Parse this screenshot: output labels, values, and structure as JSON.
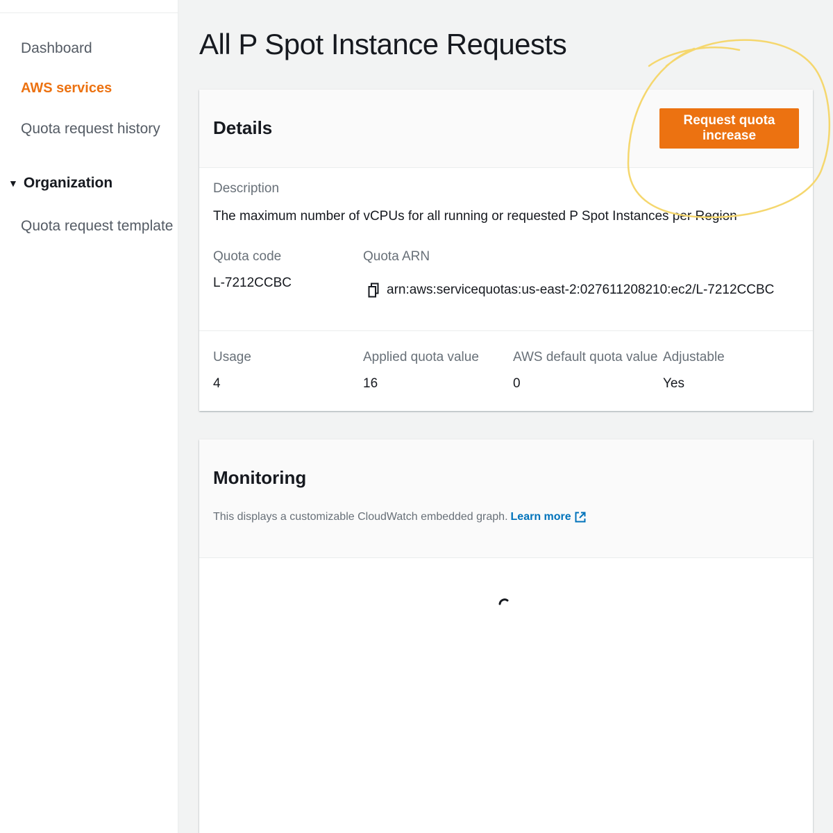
{
  "sidebar": {
    "items": [
      {
        "label": "Dashboard"
      },
      {
        "label": "AWS services",
        "active": true
      },
      {
        "label": "Quota request history"
      }
    ],
    "section": {
      "label": "Organization",
      "expanded": true
    },
    "section_items": [
      {
        "label": "Quota request template"
      }
    ]
  },
  "page": {
    "title": "All P Spot Instance Requests"
  },
  "details": {
    "title": "Details",
    "request_button": "Request quota increase",
    "description_label": "Description",
    "description": "The maximum number of vCPUs for all running or requested P Spot Instances per Region",
    "quota_code_label": "Quota code",
    "quota_code": "L-7212CCBC",
    "quota_arn_label": "Quota ARN",
    "quota_arn": "arn:aws:servicequotas:us-east-2:027611208210:ec2/L-7212CCBC",
    "copy_icon": "copy-icon",
    "usage_label": "Usage",
    "usage": "4",
    "applied_label": "Applied quota value",
    "applied": "16",
    "default_label": "AWS default quota value",
    "default": "0",
    "adjustable_label": "Adjustable",
    "adjustable": "Yes"
  },
  "monitoring": {
    "title": "Monitoring",
    "description": "This displays a customizable CloudWatch embedded graph.",
    "learn_more": "Learn more",
    "external_icon": "external-link-icon"
  },
  "colors": {
    "accent": "#ec7211",
    "link": "#0073bb",
    "annotation": "#f5d76e",
    "background": "#f2f3f3"
  }
}
